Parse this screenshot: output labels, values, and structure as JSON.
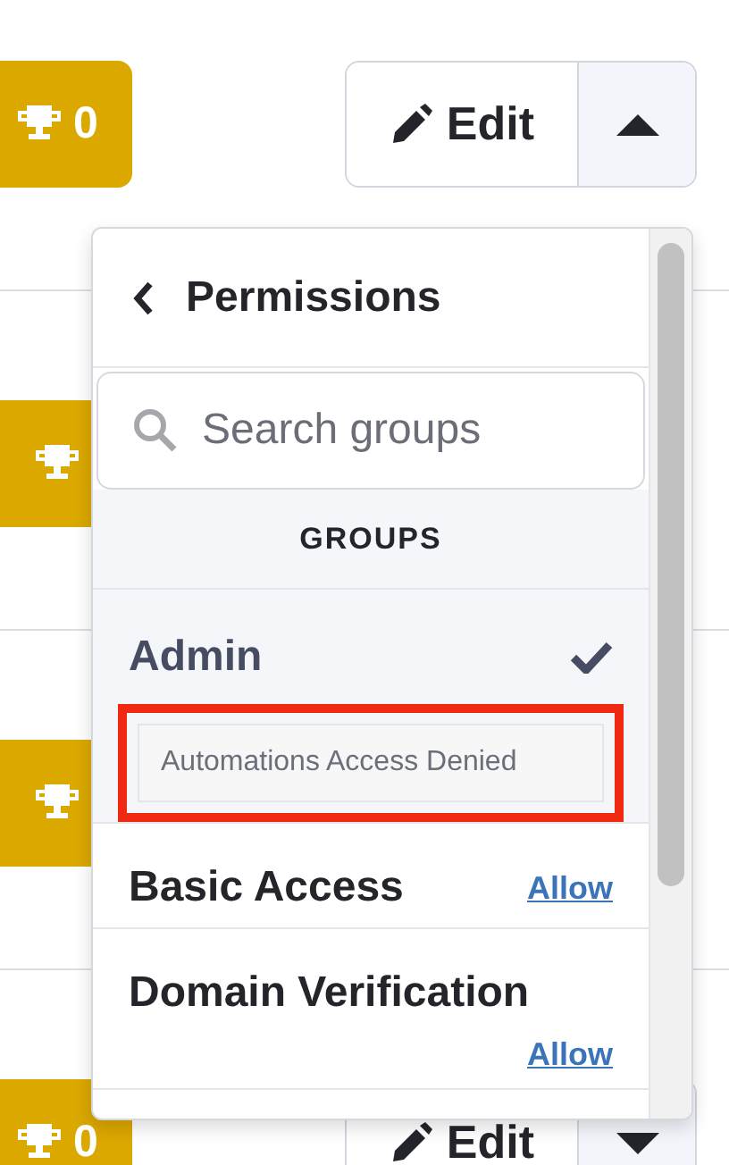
{
  "rows": [
    {
      "badge": {
        "count": "0"
      },
      "menu": {
        "label": "Edit",
        "expanded": true
      }
    },
    {
      "badge": {}
    },
    {
      "badge": {}
    },
    {
      "badge": {
        "count": "0"
      },
      "menu": {
        "label": "Edit",
        "expanded": false
      }
    }
  ],
  "dropdown": {
    "title": "Permissions",
    "search": {
      "placeholder": "Search groups"
    },
    "section": "GROUPS",
    "groups": [
      {
        "name": "Admin",
        "selected": true,
        "note": "Automations Access Denied",
        "annotated": true
      },
      {
        "name": "Basic Access",
        "selected": false,
        "action": "Allow"
      },
      {
        "name": "Domain Verification",
        "selected": false,
        "action": "Allow"
      }
    ]
  }
}
